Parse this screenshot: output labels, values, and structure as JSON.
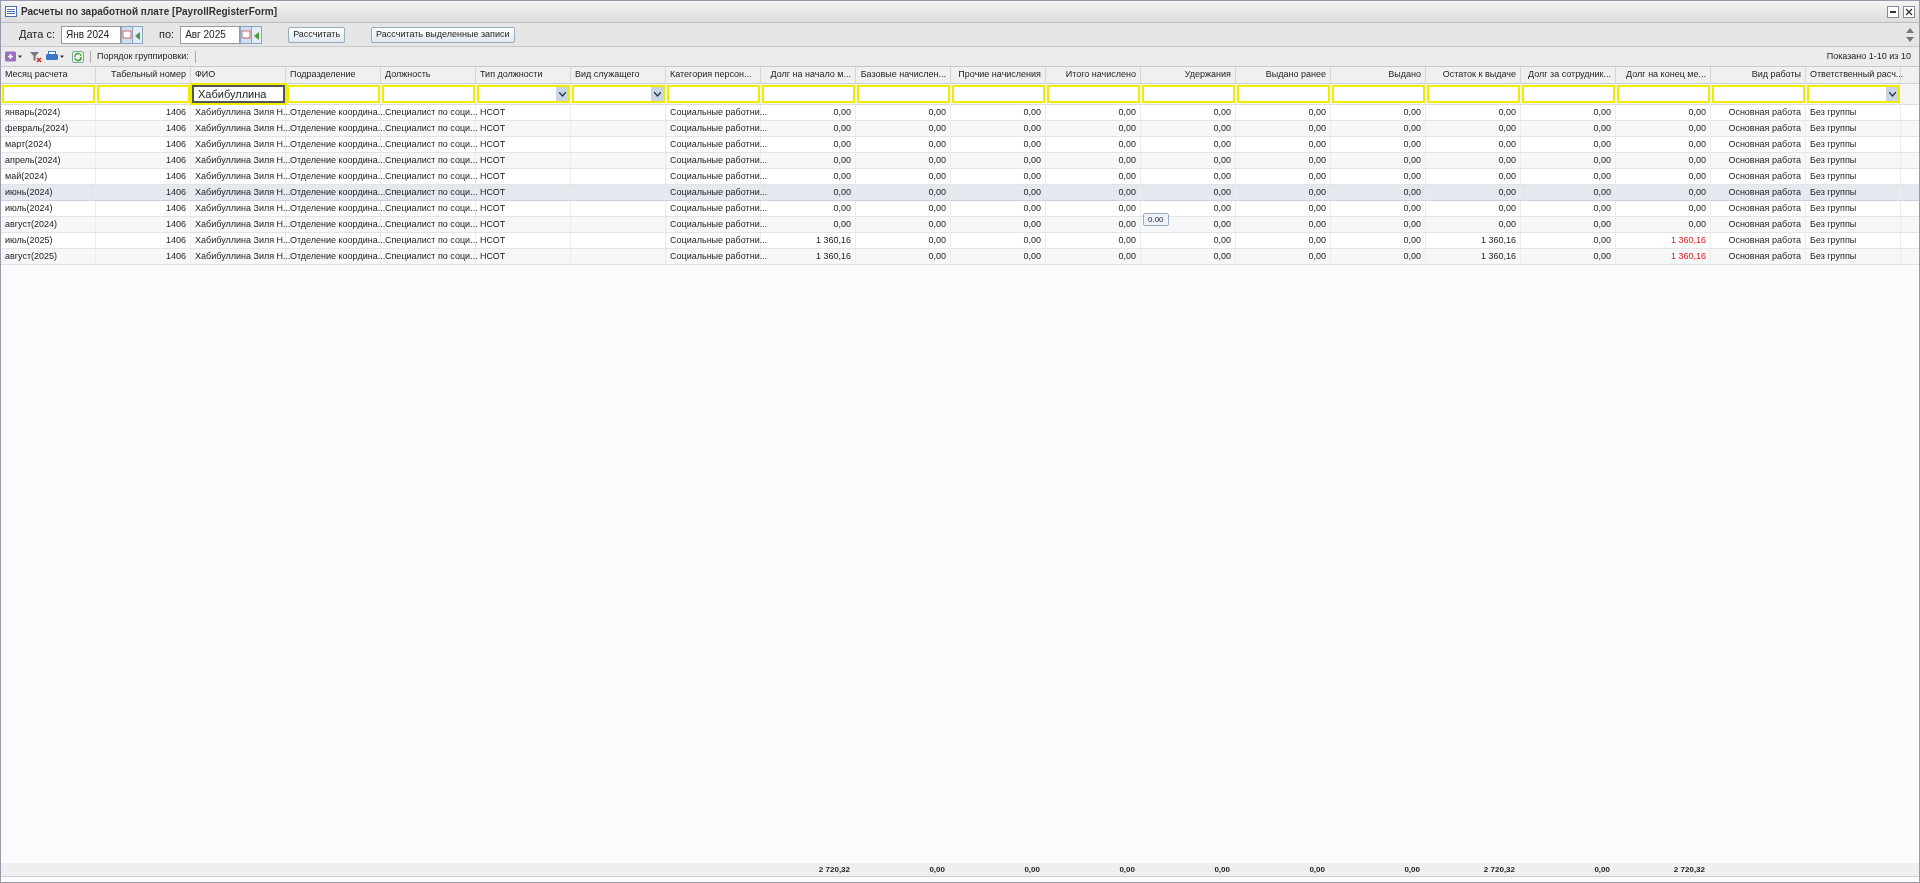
{
  "window": {
    "title": "Расчеты по заработной плате [PayrollRegisterForm]"
  },
  "period": {
    "from_label": "Дата с:",
    "from_value": "Янв 2024",
    "to_label": "по:",
    "to_value": "Авг 2025"
  },
  "buttons": [
    "Рассчитать",
    "Рассчитать выделенные записи"
  ],
  "toolbar": {
    "grouping_label": "Порядок группировки:",
    "paging": "Показано 1-10 из 10"
  },
  "columns": [
    {
      "title": "Месяц расчета",
      "kind": "text",
      "dropdown": false
    },
    {
      "title": "Табельный номер",
      "kind": "number",
      "dropdown": false
    },
    {
      "title": "ФИО",
      "kind": "text",
      "filter": "Хабибуллина",
      "dropdown": false
    },
    {
      "title": "Подразделение",
      "kind": "text",
      "dropdown": false
    },
    {
      "title": "Должность",
      "kind": "text",
      "dropdown": false
    },
    {
      "title": "Тип должности",
      "kind": "text",
      "dropdown": true
    },
    {
      "title": "Вид служащего",
      "kind": "text",
      "dropdown": true
    },
    {
      "title": "Категория персон...",
      "kind": "text",
      "dropdown": false
    },
    {
      "title": "Долг на начало м...",
      "kind": "number",
      "total": "2 720,32",
      "dropdown": false
    },
    {
      "title": "Базовые начислен...",
      "kind": "number",
      "total": "0,00",
      "dropdown": false
    },
    {
      "title": "Прочие начисления",
      "kind": "number",
      "total": "0,00",
      "dropdown": false
    },
    {
      "title": "Итого начислено",
      "kind": "number",
      "total": "0,00",
      "dropdown": false
    },
    {
      "title": "Удержания",
      "kind": "number",
      "total": "0,00",
      "dropdown": false
    },
    {
      "title": "Выдано ранее",
      "kind": "number",
      "total": "0,00",
      "dropdown": false
    },
    {
      "title": "Выдано",
      "kind": "number",
      "total": "0,00",
      "dropdown": false
    },
    {
      "title": "Остаток к выдаче",
      "kind": "number",
      "total": "2 720,32",
      "dropdown": false
    },
    {
      "title": "Долг за сотрудник...",
      "kind": "number",
      "total": "0,00",
      "dropdown": false
    },
    {
      "title": "Долг на конец ме...",
      "kind": "number",
      "total": "2 720,32",
      "dropdown": false
    },
    {
      "title": "Вид работы",
      "kind": "label",
      "dropdown": false
    },
    {
      "title": "Ответственный расч...",
      "kind": "text",
      "dropdown": true
    }
  ],
  "rows": [
    {
      "selected": false,
      "end_debt_flagged": false,
      "cells": [
        "январь(2024)",
        "1406",
        "Хабибуллина Зиля Н...",
        "Отделение координа...",
        "Специалист по соци...",
        "НСОТ",
        null,
        "Социальные работни...",
        "0,00",
        "0,00",
        "0,00",
        "0,00",
        "0,00",
        "0,00",
        "0,00",
        "0,00",
        "0,00",
        "0,00",
        "Основная работа",
        "Без группы"
      ]
    },
    {
      "selected": false,
      "end_debt_flagged": false,
      "cells": [
        "февраль(2024)",
        "1406",
        "Хабибуллина Зиля Н...",
        "Отделение координа...",
        "Специалист по соци...",
        "НСОТ",
        null,
        "Социальные работни...",
        "0,00",
        "0,00",
        "0,00",
        "0,00",
        "0,00",
        "0,00",
        "0,00",
        "0,00",
        "0,00",
        "0,00",
        "Основная работа",
        "Без группы"
      ]
    },
    {
      "selected": false,
      "end_debt_flagged": false,
      "cells": [
        "март(2024)",
        "1406",
        "Хабибуллина Зиля Н...",
        "Отделение координа...",
        "Специалист по соци...",
        "НСОТ",
        null,
        "Социальные работни...",
        "0,00",
        "0,00",
        "0,00",
        "0,00",
        "0,00",
        "0,00",
        "0,00",
        "0,00",
        "0,00",
        "0,00",
        "Основная работа",
        "Без группы"
      ]
    },
    {
      "selected": false,
      "end_debt_flagged": false,
      "cells": [
        "апрель(2024)",
        "1406",
        "Хабибуллина Зиля Н...",
        "Отделение координа...",
        "Специалист по соци...",
        "НСОТ",
        null,
        "Социальные работни...",
        "0,00",
        "0,00",
        "0,00",
        "0,00",
        "0,00",
        "0,00",
        "0,00",
        "0,00",
        "0,00",
        "0,00",
        "Основная работа",
        "Без группы"
      ]
    },
    {
      "selected": false,
      "end_debt_flagged": false,
      "cells": [
        "май(2024)",
        "1406",
        "Хабибуллина Зиля Н...",
        "Отделение координа...",
        "Специалист по соци...",
        "НСОТ",
        null,
        "Социальные работни...",
        "0,00",
        "0,00",
        "0,00",
        "0,00",
        "0,00",
        "0,00",
        "0,00",
        "0,00",
        "0,00",
        "0,00",
        "Основная работа",
        "Без группы"
      ]
    },
    {
      "selected": true,
      "end_debt_flagged": false,
      "cells": [
        "июнь(2024)",
        "1406",
        "Хабибуллина Зиля Н...",
        "Отделение координа...",
        "Специалист по соци...",
        "НСОТ",
        null,
        "Социальные работни...",
        "0,00",
        "0,00",
        "0,00",
        "0,00",
        "0,00",
        "0,00",
        "0,00",
        "0,00",
        "0,00",
        "0,00",
        "Основная работа",
        "Без группы"
      ]
    },
    {
      "selected": false,
      "end_debt_flagged": false,
      "cells": [
        "июль(2024)",
        "1406",
        "Хабибуллина Зиля Н...",
        "Отделение координа...",
        "Специалист по соци...",
        "НСОТ",
        null,
        "Социальные работни...",
        "0,00",
        "0,00",
        "0,00",
        "0,00",
        "0,00",
        "0,00",
        "0,00",
        "0,00",
        "0,00",
        "0,00",
        "Основная работа",
        "Без группы"
      ]
    },
    {
      "selected": false,
      "end_debt_flagged": false,
      "cells": [
        "август(2024)",
        "1406",
        "Хабибуллина Зиля Н...",
        "Отделение координа...",
        "Специалист по соци...",
        "НСОТ",
        null,
        "Социальные работни...",
        "0,00",
        "0,00",
        "0,00",
        "0,00",
        "0,00",
        "0,00",
        "0,00",
        "0,00",
        "0,00",
        "0,00",
        "Основная работа",
        "Без группы"
      ]
    },
    {
      "selected": false,
      "end_debt_flagged": true,
      "cells": [
        "июль(2025)",
        "1406",
        "Хабибуллина Зиля Н...",
        "Отделение координа...",
        "Специалист по соци...",
        "НСОТ",
        null,
        "Социальные работни...",
        "1 360,16",
        "0,00",
        "0,00",
        "0,00",
        "0,00",
        "0,00",
        "0,00",
        "1 360,16",
        "0,00",
        "1 360,16",
        "Основная работа",
        "Без группы"
      ]
    },
    {
      "selected": false,
      "end_debt_flagged": true,
      "cells": [
        "август(2025)",
        "1406",
        "Хабибуллина Зиля Н...",
        "Отделение координа...",
        "Специалист по соци...",
        "НСОТ",
        null,
        "Социальные работни...",
        "1 360,16",
        "0,00",
        "0,00",
        "0,00",
        "0,00",
        "0,00",
        "0,00",
        "1 360,16",
        "0,00",
        "1 360,16",
        "Основная работа",
        "Без группы"
      ]
    }
  ],
  "tooltip": {
    "text": "0.00"
  }
}
